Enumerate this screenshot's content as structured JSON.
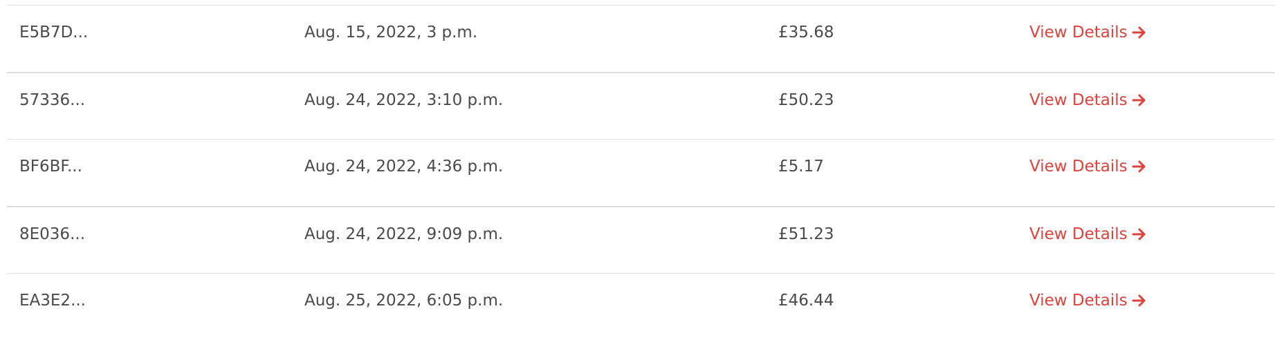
{
  "orders": [
    {
      "id": "E5B7D...",
      "date": "Aug. 15, 2022, 3 p.m.",
      "amount": "£35.68",
      "link_label": "View Details"
    },
    {
      "id": "57336...",
      "date": "Aug. 24, 2022, 3:10 p.m.",
      "amount": "£50.23",
      "link_label": "View Details"
    },
    {
      "id": "BF6BF...",
      "date": "Aug. 24, 2022, 4:36 p.m.",
      "amount": "£5.17",
      "link_label": "View Details"
    },
    {
      "id": "8E036...",
      "date": "Aug. 24, 2022, 9:09 p.m.",
      "amount": "£51.23",
      "link_label": "View Details"
    },
    {
      "id": "EA3E2...",
      "date": "Aug. 25, 2022, 6:05 p.m.",
      "amount": "£46.44",
      "link_label": "View Details"
    }
  ],
  "icons": {
    "link_arrow": "arrow-right-icon"
  },
  "colors": {
    "link": "#e0413a",
    "text": "#4a4a4a",
    "divider": "#e3e3e3"
  }
}
